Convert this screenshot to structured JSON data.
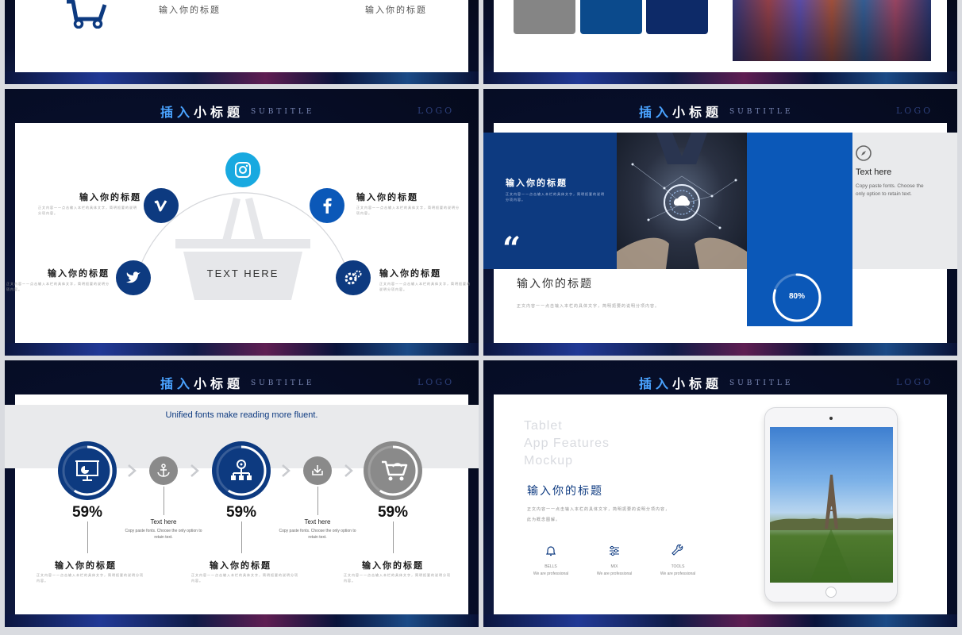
{
  "colors": {
    "navy": "#0d3a80",
    "blue": "#0b58b8",
    "cyan": "#18a9e0",
    "gray": "#8a8a8a",
    "light_gray": "#e9eaec"
  },
  "header": {
    "title_hl": "插入",
    "title_rest": "小标题",
    "subtitle": "SUBTITLE",
    "logo": "LOGO"
  },
  "slide1": {
    "title_left": "输入你的标题",
    "title_right": "输入你的标题",
    "icon": "shopping-cart-icon"
  },
  "slide2": {
    "swatches": [
      "#858585",
      "#0b4a8c",
      "#0d2a68"
    ]
  },
  "slide3": {
    "basket_label": "TEXT HERE",
    "items": [
      {
        "title": "输入你的标题",
        "desc": "正文内容一一点击输入本栏的具体文字，简明扼要的说明分项内容。",
        "icon": "vimeo-icon"
      },
      {
        "title": "输入你的标题",
        "desc": "正文内容一一点击输入本栏的具体文字，简明扼要的说明分项内容。",
        "icon": "twitter-icon"
      },
      {
        "title": "输入你的标题",
        "desc": "正文内容一一点击输入本栏的具体文字，简明扼要的说明分项内容。",
        "icon": "facebook-icon"
      },
      {
        "title": "输入你的标题",
        "desc": "正文内容一一点击输入本栏的具体文字，简明扼要的说明分项内容。",
        "icon": "gear-icon"
      }
    ],
    "top_icon": "instagram-icon"
  },
  "slide4": {
    "quote_title": "输入你的标题",
    "quote_desc": "正文内容一一点击输入本栏的具体文字，简明扼要的说明分项内容。",
    "main_title": "输入你的标题",
    "main_desc": "正文内容一一点击输入本栏的具体文字，简明扼要的说明分项内容。",
    "progress_label": "80%",
    "progress_value": 0.8,
    "side_title": "Text here",
    "side_desc": "Copy paste fonts. Choose the only option to retain text."
  },
  "slide5": {
    "banner": "Unified fonts make reading more fluent.",
    "steps": [
      {
        "percent": "59%",
        "value": 0.59,
        "title": "输入你的标题",
        "desc": "正文内容一一点击输入本栏的具体文字，简明扼要的说明分项内容。",
        "icon": "presentation-icon"
      },
      {
        "percent": "59%",
        "value": 0.59,
        "title": "输入你的标题",
        "desc": "正文内容一一点击输入本栏的具体文字，简明扼要的说明分项内容。",
        "icon": "org-chart-icon"
      },
      {
        "percent": "59%",
        "value": 0.59,
        "title": "输入你的标题",
        "desc": "正文内容一一点击输入本栏的具体文字，简明扼要的说明分项内容。",
        "icon": "cart-icon"
      }
    ],
    "mid": [
      {
        "title": "Text here",
        "desc": "Copy paste fonts. Choose the only option to retain text.",
        "icon": "anchor-icon"
      },
      {
        "title": "Text here",
        "desc": "Copy paste fonts. Choose the only option to retain text.",
        "icon": "download-icon"
      }
    ]
  },
  "slide6": {
    "heading_lines": [
      "Tablet",
      "App Features",
      "Mockup"
    ],
    "title": "输入你的标题",
    "desc": "正文内容一一点击输入本栏的具体文字，简明扼要的说明分项内容，此为概念图解。",
    "features": [
      {
        "name": "BELLS",
        "desc": "We are professional",
        "icon": "bell-icon"
      },
      {
        "name": "MIX",
        "desc": "We are professional",
        "icon": "sliders-icon"
      },
      {
        "name": "TOOLS",
        "desc": "We are professional",
        "icon": "wrench-icon"
      }
    ]
  }
}
